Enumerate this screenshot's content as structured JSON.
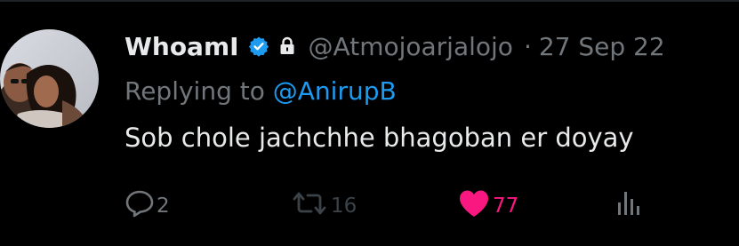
{
  "tweet": {
    "display_name": "WhoamI",
    "handle": "@Atmojoarjalojo",
    "separator": "·",
    "date": "27 Sep 22",
    "replying_prefix": "Replying to",
    "replying_to": "@AnirupB",
    "text": "Sob chole jachchhe bhagoban er doyay"
  },
  "actions": {
    "reply_count": "2",
    "retweet_count": "16",
    "like_count": "77"
  },
  "icons": {
    "verified": "verified-badge-icon",
    "lock": "lock-icon",
    "reply": "reply-icon",
    "retweet": "retweet-icon",
    "like": "heart-icon",
    "views": "analytics-icon"
  },
  "colors": {
    "background": "#000000",
    "primary_text": "#e7e9ea",
    "secondary_text": "#71767b",
    "link": "#1d9bf0",
    "like": "#f91880",
    "verified": "#1d9bf0"
  }
}
